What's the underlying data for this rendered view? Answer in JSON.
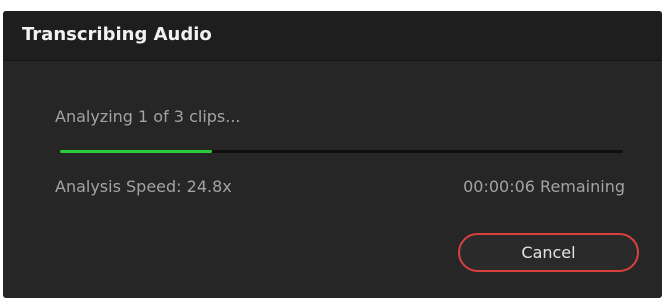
{
  "dialog": {
    "title": "Transcribing Audio",
    "status_text": "Analyzing 1 of 3 clips...",
    "progress": 0.27,
    "speed_text": "Analysis Speed: 24.8x",
    "remaining_text": "00:00:06 Remaining",
    "cancel_label": "Cancel"
  },
  "colors": {
    "progress_fill": "#2ccf3a",
    "cancel_border": "#d9413f",
    "background": "#262626"
  }
}
